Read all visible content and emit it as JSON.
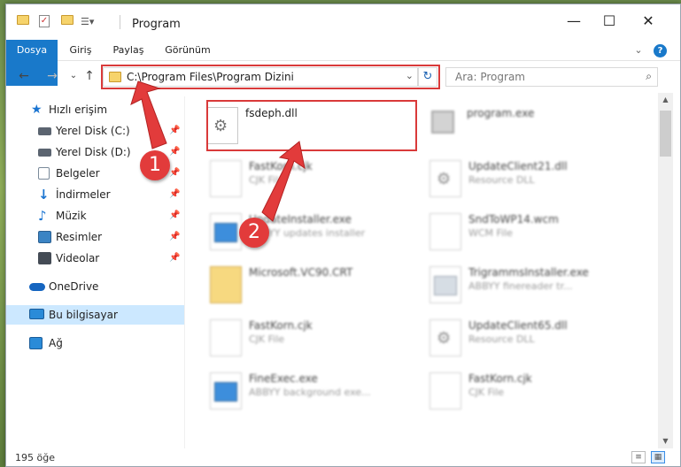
{
  "window": {
    "title": "Program",
    "minimize": "—",
    "maximize": "☐",
    "close": "✕"
  },
  "ribbon": {
    "tabs": [
      "Dosya",
      "Giriş",
      "Paylaş",
      "Görünüm"
    ],
    "expand": "⌄",
    "help": "?"
  },
  "nav": {
    "back": "←",
    "forward": "→",
    "recent": "⌄",
    "up": "↑",
    "address": "C:\\Program Files\\Program Dizini",
    "address_chevron": "⌄",
    "refresh": "↻",
    "search_placeholder": "Ara: Program",
    "search_icon": "⌕"
  },
  "sidebar": {
    "items": [
      {
        "label": "Hızlı erişim",
        "icon": "star-icon",
        "color": "#1a74d1"
      },
      {
        "label": "Yerel Disk (C:)",
        "icon": "drive-icon",
        "color": "#5b6470",
        "pinned": true
      },
      {
        "label": "Yerel Disk (D:)",
        "icon": "drive-icon",
        "color": "#5b6470",
        "pinned": true
      },
      {
        "label": "Belgeler",
        "icon": "document-icon",
        "color": "#dde6ef",
        "pinned": true
      },
      {
        "label": "İndirmeler",
        "icon": "download-icon",
        "color": "#1a74d1",
        "pinned": true
      },
      {
        "label": "Müzik",
        "icon": "music-icon",
        "color": "#1a74d1",
        "pinned": true
      },
      {
        "label": "Resimler",
        "icon": "pictures-icon",
        "color": "#3b84c4",
        "pinned": true
      },
      {
        "label": "Videolar",
        "icon": "video-icon",
        "color": "#444b55",
        "pinned": true
      },
      {
        "label": "OneDrive",
        "icon": "cloud-icon",
        "color": "#1565c0"
      },
      {
        "label": "Bu bilgisayar",
        "icon": "computer-icon",
        "color": "#2a8bd8",
        "selected": true
      },
      {
        "label": "Ağ",
        "icon": "network-icon",
        "color": "#2a8bd8"
      }
    ],
    "pin_glyph": "📌"
  },
  "files": [
    {
      "name": "fsdeph.dll",
      "sub": "",
      "icon": "gear",
      "blurred": false
    },
    {
      "name": "program.exe",
      "sub": "",
      "icon": "program",
      "blurred": true
    },
    {
      "name": "FastKorn.cjk",
      "sub": "CJK File",
      "icon": "blank",
      "blurred": true
    },
    {
      "name": "UpdateClient21.dll",
      "sub": "Resource DLL",
      "icon": "gear",
      "blurred": true
    },
    {
      "name": "UpdateInstaller.exe",
      "sub": "ABBYY updates installer",
      "icon": "app",
      "blurred": true
    },
    {
      "name": "SndToWP14.wcm",
      "sub": "WCM File",
      "icon": "blank",
      "blurred": true
    },
    {
      "name": "Microsoft.VC90.CRT",
      "sub": "",
      "icon": "folder",
      "blurred": true
    },
    {
      "name": "TrigrammsInstaller.exe",
      "sub": "ABBYY finereader tr...",
      "icon": "app",
      "blurred": true
    },
    {
      "name": "FastKorn.cjk",
      "sub": "CJK File",
      "icon": "blank",
      "blurred": true
    },
    {
      "name": "UpdateClient65.dll",
      "sub": "Resource DLL",
      "icon": "gear",
      "blurred": true
    },
    {
      "name": "FineExec.exe",
      "sub": "ABBYY background exe...",
      "icon": "app",
      "blurred": true
    },
    {
      "name": "FastKorn.cjk",
      "sub": "CJK File",
      "icon": "blank",
      "blurred": true
    }
  ],
  "annotations": {
    "step1": "1",
    "step2": "2",
    "highlight_color": "#d93a3a"
  },
  "status": {
    "count": "195 öğe",
    "details_view": "≡",
    "icons_view": "▦"
  }
}
